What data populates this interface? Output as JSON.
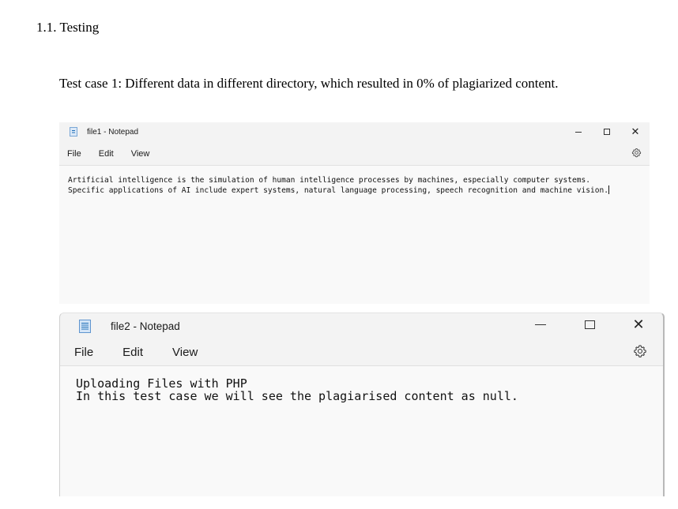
{
  "doc": {
    "heading": "1.1. Testing",
    "paragraph": "Test case 1: Different data in different directory, which resulted in 0% of plagiarized content."
  },
  "window1": {
    "title": "file1 - Notepad",
    "menu": [
      "File",
      "Edit",
      "View"
    ],
    "controls": {
      "minimize": "—",
      "maximize": "☐",
      "close": "✕"
    },
    "lines": [
      "Artificial intelligence is the simulation of human intelligence processes by machines, especially computer systems.",
      "Specific applications of AI include expert systems, natural language processing, speech recognition and machine vision."
    ]
  },
  "window2": {
    "title": "file2 - Notepad",
    "menu": [
      "File",
      "Edit",
      "View"
    ],
    "controls": {
      "minimize": "—",
      "maximize": "☐",
      "close": "✕"
    },
    "lines": [
      "Uploading Files with PHP",
      "In this test case we will see the plagiarised content as null."
    ]
  },
  "icons": {
    "app": "notepad-icon",
    "settings": "gear-icon",
    "minimize": "minimize-icon",
    "maximize": "maximize-icon",
    "close": "close-icon"
  },
  "colors": {
    "window_bg": "#f3f3f3",
    "editor_bg": "#f9f9f9",
    "icon_blue": "#1f6fb8"
  }
}
